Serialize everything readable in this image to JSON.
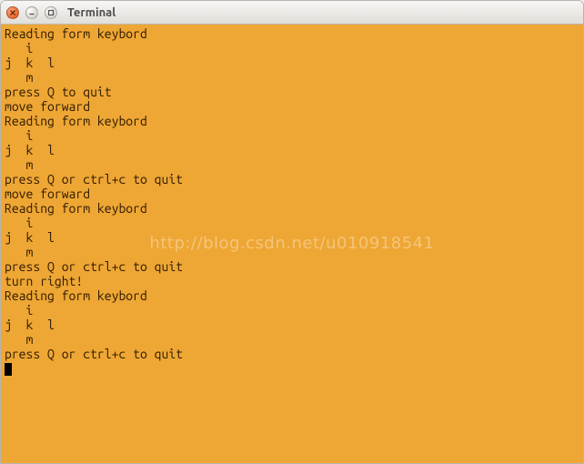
{
  "window": {
    "title": "Terminal"
  },
  "terminal": {
    "lines": [
      "Reading form keybord",
      "   i",
      "j  k  l",
      "   m",
      "press Q to quit",
      "move forward",
      "Reading form keybord",
      "   i",
      "j  k  l",
      "   m",
      "press Q or ctrl+c to quit",
      "move forward",
      "Reading form keybord",
      "   i",
      "j  k  l",
      "   m",
      "press Q or ctrl+c to quit",
      "turn right!",
      "Reading form keybord",
      "   i",
      "j  k  l",
      "   m",
      "press Q or ctrl+c to quit"
    ]
  },
  "watermark": {
    "text": "http://blog.csdn.net/u010918541"
  }
}
